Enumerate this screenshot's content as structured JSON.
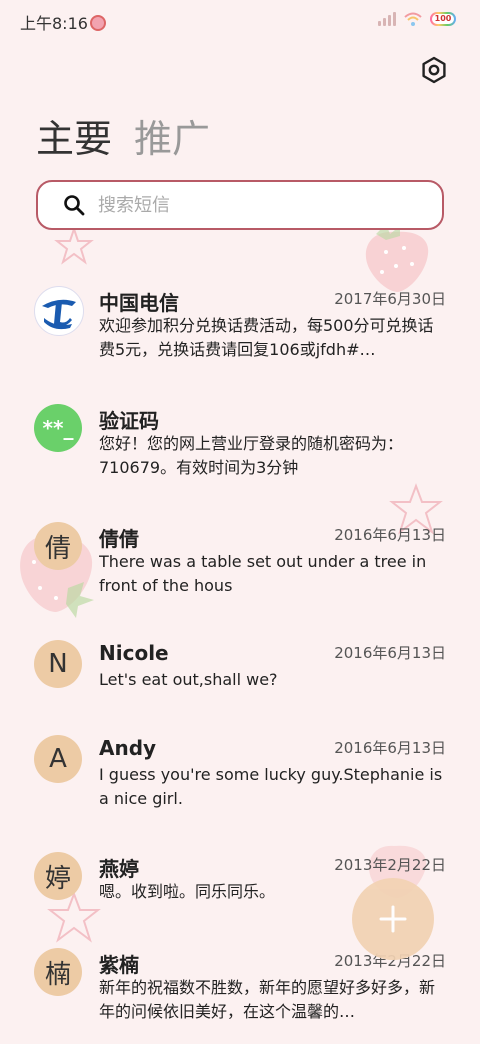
{
  "status_bar": {
    "time": "上午8:16",
    "battery": "100",
    "icons": [
      "emoji-icon",
      "signal-icon",
      "wifi-icon",
      "battery-icon"
    ]
  },
  "header": {
    "settings_icon": "gear-icon",
    "tabs": [
      {
        "label": "主要"
      },
      {
        "label": "推广"
      }
    ]
  },
  "search": {
    "placeholder": "搜索短信",
    "icon": "search-icon"
  },
  "messages": [
    {
      "sender": "中国电信",
      "date": "2017年6月30日",
      "preview": "欢迎参加积分兑换话费活动，每500分可兑换话费5元，兑换话费请回复106或jfdh#…",
      "avatar_type": "logo"
    },
    {
      "sender": "验证码",
      "date": "",
      "preview": "您好！您的网上营业厅登录的随机密码为：710679。有效时间为3分钟",
      "avatar_type": "code",
      "avatar_text": "**_"
    },
    {
      "sender": "倩倩",
      "date": "2016年6月13日",
      "preview": "There was a table set out under a tree in front of the hous",
      "avatar_text": "倩"
    },
    {
      "sender": "Nicole",
      "date": "2016年6月13日",
      "preview": "Let's eat out,shall we?",
      "avatar_text": "N"
    },
    {
      "sender": "Andy",
      "date": "2016年6月13日",
      "preview": "I guess you're some lucky guy.Stephanie is a nice girl.",
      "avatar_text": "A"
    },
    {
      "sender": "燕婷",
      "date": "2013年2月22日",
      "preview": "嗯。收到啦。同乐同乐。",
      "avatar_text": "婷"
    },
    {
      "sender": "紫楠",
      "date": "2013年2月22日",
      "preview": "新年的祝福数不胜数，新年的愿望好多好多，新年的问候依旧美好，在这个温馨的…",
      "avatar_text": "楠"
    }
  ],
  "fab": {
    "icon": "plus-icon"
  },
  "colors": {
    "background": "#fcf1f1",
    "search_border": "#b85a66",
    "avatar_bg": "#edcba5",
    "code_avatar_bg": "#6ad06a",
    "fab_bg": "#f2d2b3",
    "telecom_blue": "#1a5bb0"
  }
}
